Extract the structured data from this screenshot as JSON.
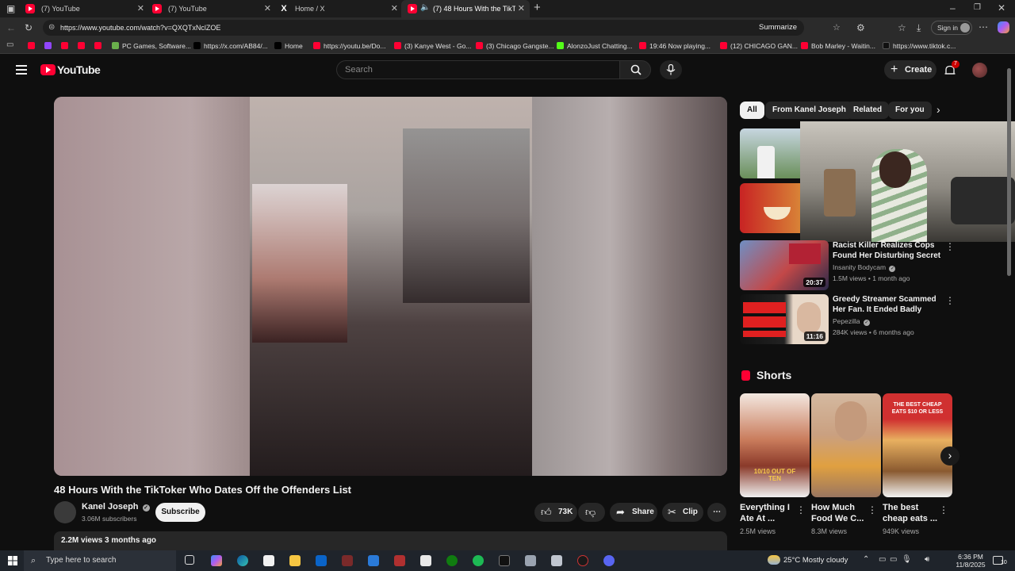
{
  "browser": {
    "tabs": [
      {
        "title": "(7) YouTube",
        "icon": "youtube-icon"
      },
      {
        "title": "(7) YouTube",
        "icon": "youtube-icon"
      },
      {
        "title": "Home / X",
        "icon": "x-icon"
      },
      {
        "title": "(7) 48 Hours With the TikTok",
        "icon": "youtube-icon",
        "active": true
      }
    ],
    "url": "https://www.youtube.com/watch?v=QXQTxNclZOE",
    "summarize_label": "Summarize",
    "signin_label": "Sign in",
    "bookmarks": [
      {
        "label": "PC Games, Software...",
        "color": "#6ab04c"
      },
      {
        "label": "https://x.com/AB84/...",
        "color": "#000000"
      },
      {
        "label": "Home",
        "color": "#000000"
      },
      {
        "label": "https://youtu.be/Do...",
        "color": "#ff0033"
      },
      {
        "label": "(3) Kanye West - Go...",
        "color": "#ff0033"
      },
      {
        "label": "(3) Chicago Gangste...",
        "color": "#ff0033"
      },
      {
        "label": "AlonzoJust Chatting...",
        "color": "#53fc18"
      },
      {
        "label": "19:46 Now playing...",
        "color": "#ff0033"
      },
      {
        "label": "(12) CHICAGO GAN...",
        "color": "#ff0033"
      },
      {
        "label": "Bob Marley - Waitin...",
        "color": "#ff0033"
      },
      {
        "label": "https://www.tiktok.c...",
        "color": "#111111"
      }
    ]
  },
  "youtube": {
    "logo_text": "YouTube",
    "search_placeholder": "Search",
    "create_label": "Create",
    "notification_count": "7",
    "video": {
      "title": "48 Hours With the TikToker Who Dates Off the Offenders List",
      "channel": "Kanel Joseph",
      "subscribers": "3.06M subscribers",
      "subscribe_label": "Subscribe",
      "likes": "73K",
      "share_label": "Share",
      "clip_label": "Clip",
      "views_date": "2.2M views  3 months ago"
    },
    "chips": [
      "All",
      "From Kanel Joseph",
      "Related",
      "For you"
    ],
    "recommendations": [
      {
        "title": "Racist Killer Realizes Cops Found Her Disturbing Secret",
        "channel": "Insanity Bodycam",
        "meta": "1.5M views • 1 month ago",
        "duration": "20:37"
      },
      {
        "title": "Greedy Streamer Scammed Her Fan. It Ended Badly",
        "channel": "Pepezilla",
        "meta": "284K views • 6 months ago",
        "duration": "11:16"
      }
    ],
    "shorts_heading": "Shorts",
    "shorts": [
      {
        "title": "Everything I Ate At ...",
        "views": "2.5M views",
        "overlay": "10/10 OUT OF TEN"
      },
      {
        "title": "How Much Food We C...",
        "views": "8.3M views",
        "overlay": ""
      },
      {
        "title": "The best cheap eats ...",
        "views": "949K views",
        "overlay": "THE BEST CHEAP EATS $10 OR LESS"
      }
    ]
  },
  "taskbar": {
    "search_placeholder": "Type here to search",
    "weather": "25°C  Mostly cloudy",
    "time": "6:36 PM",
    "date": "11/8/2025",
    "notification_count": "10"
  }
}
